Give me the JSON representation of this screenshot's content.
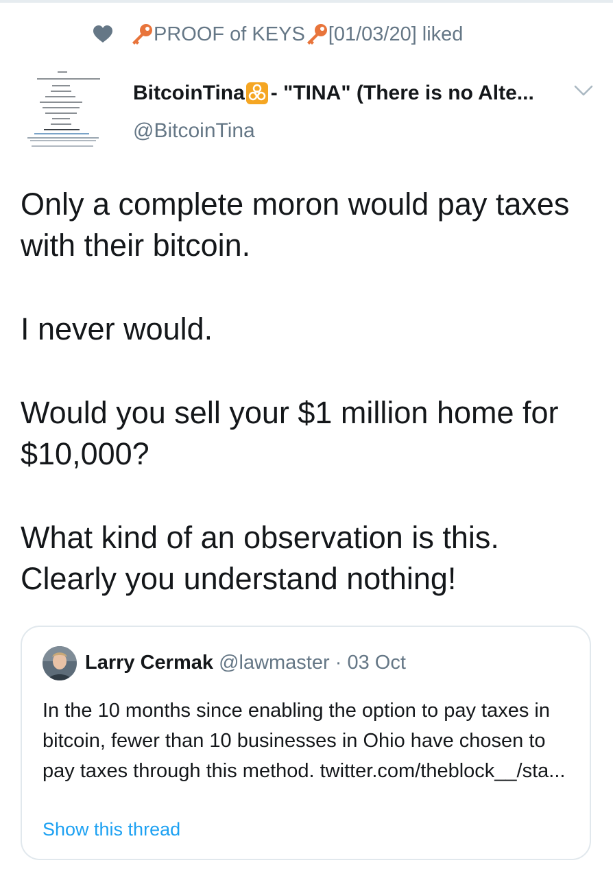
{
  "liked_header": {
    "liker_name": "PROOF of KEYS",
    "liker_date": "[01/03/20]",
    "action": "liked"
  },
  "author": {
    "name_start": "BitcoinTina",
    "name_end": "- \"TINA\" (There is no Alte...",
    "handle": "@BitcoinTina"
  },
  "tweet": {
    "paragraphs": [
      "Only a complete moron would pay taxes with their bitcoin.",
      "I never would.",
      "Would you sell your $1 million home for $10,000?",
      "What kind of an observation is this. Clearly you understand nothing!"
    ]
  },
  "quoted_tweet": {
    "author_name": "Larry Cermak",
    "author_handle": "@lawmaster",
    "date": "03 Oct",
    "text": "In the 10 months since enabling the option to pay taxes in bitcoin, fewer than 10 businesses in Ohio have chosen to pay taxes through this method. twitter.com/theblock__/sta...",
    "show_thread_label": "Show this thread"
  },
  "colors": {
    "text_primary": "#14171a",
    "text_secondary": "#657786",
    "link": "#1da1f2",
    "border": "#e1e8ed",
    "key_orange": "#e8743b",
    "biohazard_yellow": "#f5a623"
  },
  "icons": {
    "liked": "heart-icon",
    "key": "key-icon",
    "biohazard": "biohazard-icon",
    "more": "chevron-down-icon"
  }
}
